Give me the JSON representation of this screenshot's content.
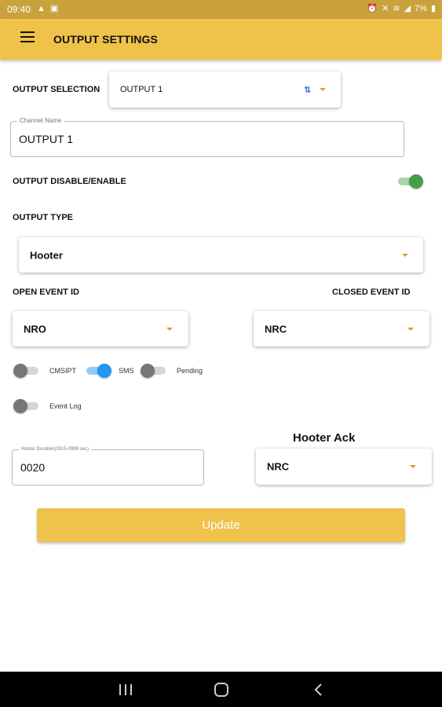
{
  "status_bar": {
    "time": "09:40",
    "battery": "7%",
    "left_icons": [
      "warning-icon",
      "sim-icon"
    ],
    "right_icons": [
      "alarm-icon",
      "mute-icon",
      "wifi-icon",
      "signal-icon",
      "battery-icon"
    ]
  },
  "app_bar": {
    "title": "OUTPUT SETTINGS"
  },
  "output_selection": {
    "label": "OUTPUT SELECTION",
    "value": "OUTPUT 1"
  },
  "channel_name": {
    "label": "Channel Name",
    "value": "OUTPUT 1"
  },
  "enable": {
    "label": "OUTPUT DISABLE/ENABLE",
    "on": true
  },
  "output_type": {
    "label": "OUTPUT TYPE",
    "value": "Hooter"
  },
  "open_event": {
    "label": "OPEN EVENT ID",
    "value": "NRO"
  },
  "closed_event": {
    "label": "CLOSED EVENT ID",
    "value": "NRC"
  },
  "toggles": [
    {
      "label": "CMSIPT",
      "on": false
    },
    {
      "label": "SMS",
      "on": true
    },
    {
      "label": "Pending",
      "on": false
    },
    {
      "label": "Event Log",
      "on": false
    }
  ],
  "hooter_duration": {
    "label": "Hooter Duration(0015-0999 sec)",
    "value": "0020"
  },
  "hooter_ack": {
    "label": "Hooter Ack",
    "value": "NRC"
  },
  "update_label": "Update",
  "colors": {
    "accent": "#efc24a",
    "status_bar": "#c9a23c",
    "toggle_on": "#2196f3",
    "enable_on": "#43a047"
  }
}
